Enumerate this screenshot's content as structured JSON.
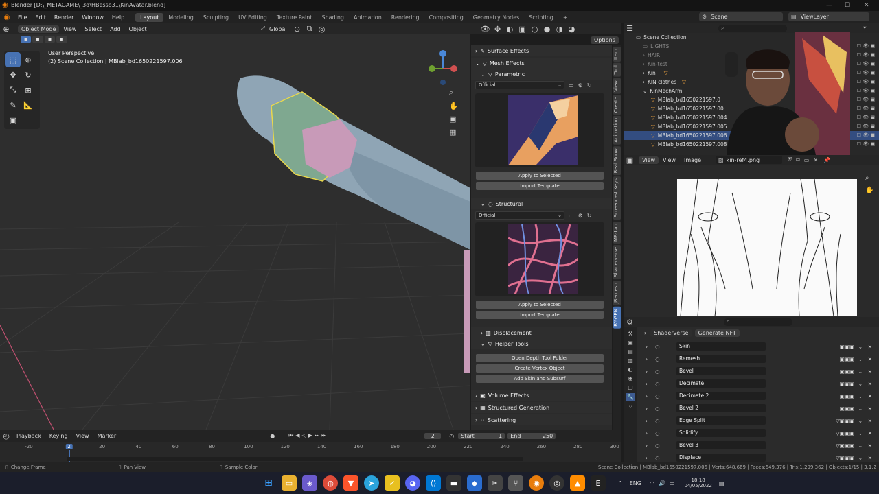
{
  "window": {
    "title": "Blender [D:\\_METAGAME\\_3d\\HBesso31\\KinAvatar.blend]"
  },
  "menu": [
    "File",
    "Edit",
    "Render",
    "Window",
    "Help"
  ],
  "workspaces": [
    "Layout",
    "Modeling",
    "Sculpting",
    "UV Editing",
    "Texture Paint",
    "Shading",
    "Animation",
    "Rendering",
    "Compositing",
    "Geometry Nodes",
    "Scripting"
  ],
  "topright": {
    "scene": "Scene",
    "viewlayer": "ViewLayer"
  },
  "viewport": {
    "mode": "Object Mode",
    "menus": [
      "View",
      "Select",
      "Add",
      "Object"
    ],
    "transform": "Global",
    "overlay_title": "User Perspective",
    "overlay_sub": "(2) Scene Collection | MBlab_bd1650221597.006",
    "options": "Options"
  },
  "npanel": {
    "surface": "Surface Effects",
    "mesh": "Mesh Effects",
    "parametric": "Parametric",
    "dropdown1": "Official",
    "apply1": "Apply to Selected",
    "import1": "Import Template",
    "structural": "Structural",
    "dropdown2": "Official",
    "apply2": "Apply to Selected",
    "import2": "Import Template",
    "displacement": "Displacement",
    "helper": "Helper Tools",
    "depth": "Open Depth Tool Folder",
    "vertex": "Create Vertex Object",
    "skin": "Add Skin and Subsurf",
    "volume": "Volume Effects",
    "structured": "Structured Generation",
    "scattering": "Scattering"
  },
  "sidetabs": [
    "Item",
    "Tool",
    "View",
    "Create",
    "Animation",
    "Real Snow",
    "Screencast Keys",
    "MB-Lab",
    "Shaderverse",
    "JRemesh",
    "BY-GEN"
  ],
  "outliner": {
    "root": "Scene Collection",
    "items": [
      "LIGHTS",
      "HAIR",
      "Kin-test",
      "Kin",
      "KIN clothes",
      "KinMechArm",
      "MBlab_bd1650221597.0",
      "MBlab_bd1650221597.00",
      "MBlab_bd1650221597.004",
      "MBlab_bd1650221597.005",
      "MBlab_bd1650221597.006",
      "MBlab_bd1650221597.008"
    ]
  },
  "imageeditor": {
    "menus": [
      "View",
      "View",
      "Image"
    ],
    "image": "kin-ref4.png"
  },
  "properties": {
    "tabs": [
      "Shaderverse",
      "Generate NFT"
    ],
    "modifiers": [
      "Skin",
      "Remesh",
      "Bevel",
      "Decimate",
      "Decimate 2",
      "Bevel 2",
      "Edge Split",
      "Solidify",
      "Bevel 3",
      "Displace"
    ]
  },
  "timeline": {
    "menus": [
      "Playback",
      "Keying",
      "View",
      "Marker"
    ],
    "frame": "2",
    "start_label": "Start",
    "start": "1",
    "end_label": "End",
    "end": "250",
    "ticks": [
      "-20",
      "2",
      "20",
      "40",
      "60",
      "80",
      "100",
      "120",
      "140",
      "160",
      "180",
      "200",
      "220",
      "240",
      "260",
      "280",
      "300"
    ]
  },
  "status": {
    "left1": "Change Frame",
    "left2": "Pan View",
    "left3": "Sample Color",
    "right": "Scene Collection | MBlab_bd1650221597.006 | Verts:648,669 | Faces:649,376 | Tris:1,299,362 | Objects:1/15 | 3.1.2"
  },
  "taskbar": {
    "lang": "ENG",
    "time": "18:18",
    "date": "04/05/2022"
  }
}
